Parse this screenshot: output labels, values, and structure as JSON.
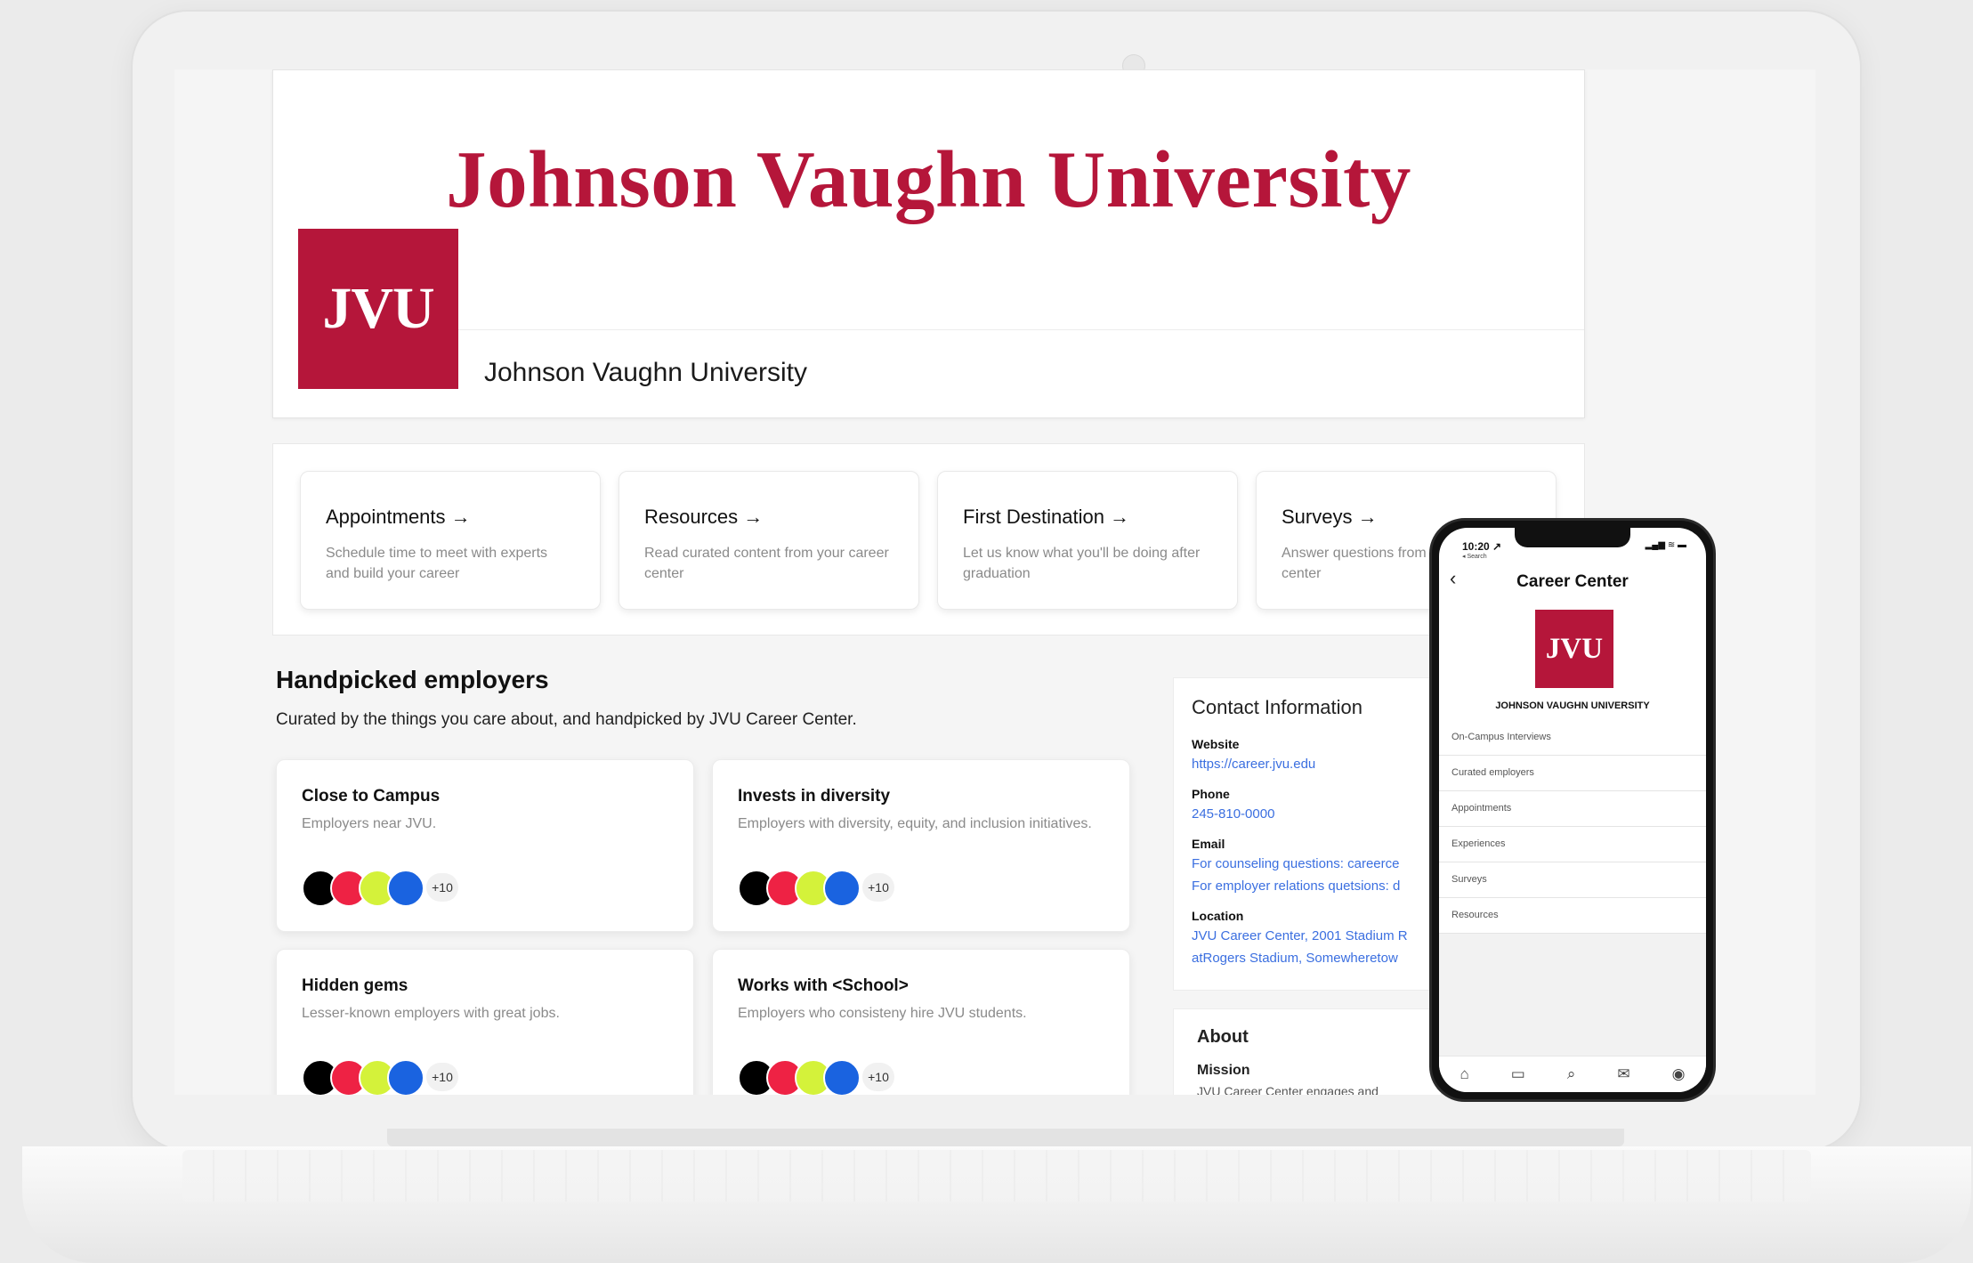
{
  "web": {
    "banner_title": "Johnson Vaughn University",
    "logo_text": "JVU",
    "org_name": "Johnson Vaughn University",
    "quick_links": [
      {
        "title": "Appointments →",
        "desc": "Schedule time to meet with experts and build your career"
      },
      {
        "title": "Resources →",
        "desc": "Read curated content from your career center"
      },
      {
        "title": "First Destination →",
        "desc": "Let us know what you'll be doing after graduation"
      },
      {
        "title": "Surveys →",
        "desc": "Answer questions from your career center"
      }
    ],
    "handpicked": {
      "title": "Handpicked employers",
      "subtitle": "Curated by the things you care about, and handpicked by JVU Career Center.",
      "cards": [
        {
          "title": "Close to Campus",
          "desc": "Employers near JVU.",
          "more": "+10"
        },
        {
          "title": "Invests in diversity",
          "desc": "Employers with diversity, equity, and inclusion initiatives.",
          "more": "+10"
        },
        {
          "title": "Hidden gems",
          "desc": "Lesser-known employers with great jobs.",
          "more": "+10"
        },
        {
          "title": "Works with <School>",
          "desc": "Employers who consisteny hire JVU students.",
          "more": "+10"
        }
      ],
      "dot_colors": [
        "#000000",
        "#ee2244",
        "#d4f23a",
        "#1a63e0"
      ]
    },
    "contact": {
      "title": "Contact Information",
      "website_label": "Website",
      "website": "https://career.jvu.edu",
      "phone_label": "Phone",
      "phone": "245-810-0000",
      "email_label": "Email",
      "email_1": "For counseling questions: careerce",
      "email_2": "For employer relations quetsions: d",
      "location_label": "Location",
      "location_1": "JVU Career Center, 2001 Stadium R",
      "location_2": "atRogers Stadium, Somewheretow"
    },
    "about": {
      "title": "About",
      "mission_label": "Mission",
      "mission_text": "JVU Career Center engages and"
    }
  },
  "phone": {
    "time": "10:20 ↗",
    "sub": "◂ Search",
    "status": "▂▄▆ ≋ ▬",
    "title": "Career Center",
    "logo_text": "JVU",
    "org": "JOHNSON VAUGHN UNIVERSITY",
    "menu": [
      "On-Campus Interviews",
      "Curated employers",
      "Appointments",
      "Experiences",
      "Surveys",
      "Resources"
    ],
    "nav_icons": [
      "home-icon",
      "calendar-icon",
      "search-icon",
      "inbox-icon",
      "profile-icon"
    ]
  },
  "colors": {
    "brand": "#b5163a",
    "link": "#3b6fe0"
  }
}
